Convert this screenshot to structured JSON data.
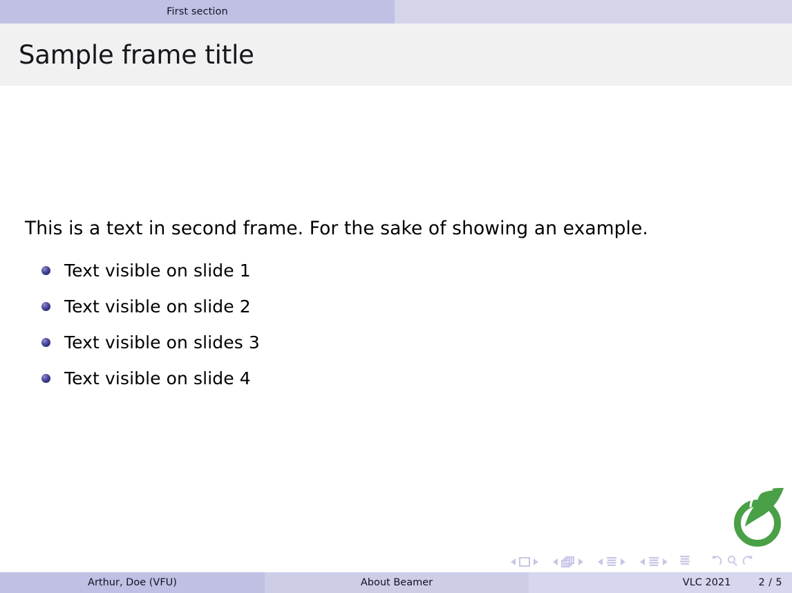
{
  "navbar": {
    "current_section": "First section",
    "colors": {
      "current": "#C0C0E4",
      "inactive": "#D5D5EA"
    }
  },
  "frame": {
    "title": "Sample frame title",
    "titlebar_color": "#F1F1F1"
  },
  "content": {
    "paragraph": "This is a text in second frame.  For the sake of showing an example.",
    "bullets": [
      {
        "label": "Text visible on slide 1"
      },
      {
        "label": "Text visible on slide 2"
      },
      {
        "label": "Text visible on slides 3"
      },
      {
        "label": "Text visible on slide 4"
      }
    ],
    "bullet_color": "#2B2B72"
  },
  "logo": {
    "name": "overleaf-logo",
    "color": "#49A047"
  },
  "nav_symbols": {
    "items": [
      "prev-slide-icon",
      "slide-icon",
      "next-slide-icon",
      "prev-frame-icon",
      "frame-icon",
      "next-frame-icon",
      "prev-subsection-icon",
      "subsection-icon",
      "next-subsection-icon",
      "prev-section-icon",
      "section-icon",
      "next-section-icon",
      "presentation-icon",
      "back-icon",
      "search-icon",
      "forward-icon"
    ],
    "color": "#C6C6E6"
  },
  "footer": {
    "author": "Arthur, Doe  (VFU)",
    "short_title": "About Beamer",
    "date": "VLC 2021",
    "page": "2 / 5",
    "colors": {
      "author": "#C0C0E4",
      "title": "#CDCDE8",
      "date": "#D6D6EE"
    }
  }
}
